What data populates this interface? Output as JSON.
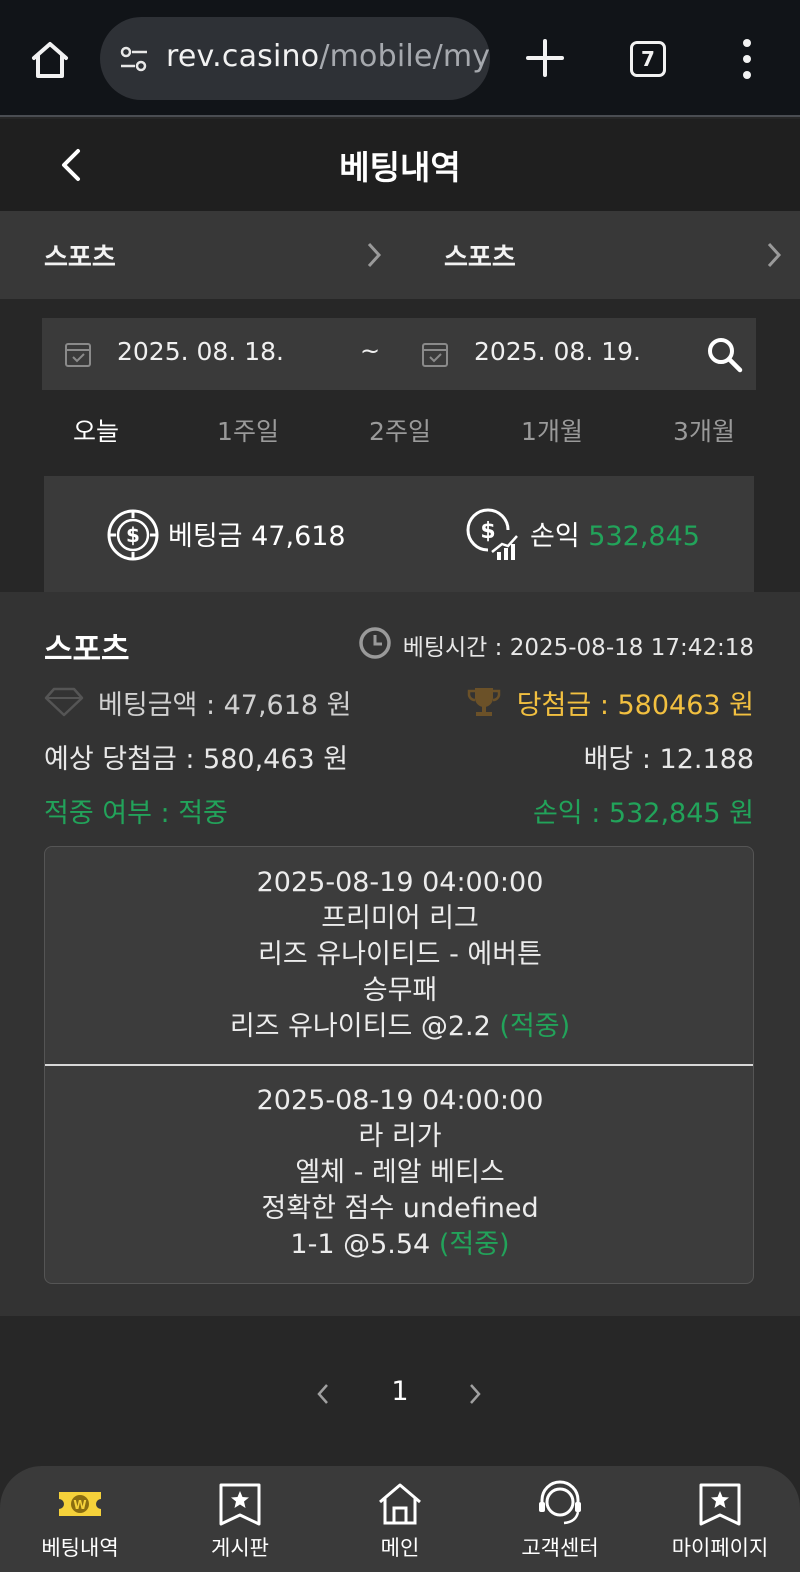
{
  "browser": {
    "url_host": "rev.casino",
    "url_path": "/mobile/my",
    "tab_count": "7"
  },
  "header": {
    "title": "베팅내역"
  },
  "filters": {
    "left_label": "스포츠",
    "right_label": "스포츠"
  },
  "date_range": {
    "from": "2025. 08. 18.",
    "separator": "~",
    "to": "2025. 08. 19."
  },
  "periods": [
    "오늘",
    "1주일",
    "2주일",
    "1개월",
    "3개월"
  ],
  "summary": {
    "bet_label": "베팅금",
    "bet_value": "47,618",
    "profit_label": "손익",
    "profit_value": "532,845"
  },
  "bet": {
    "kind": "스포츠",
    "time_text": "베팅시간 : 2025-08-18 17:42:18",
    "amount_text": "베팅금액 : 47,618 원",
    "winnings_text": "당첨금 : 580463 원",
    "expected_text": "예상 당첨금 : 580,463 원",
    "odds_text": "배당 : 12.188",
    "hit_text": "적중 여부 : 적중",
    "profit_text": "손익 : 532,845 원",
    "picks": [
      {
        "datetime": "2025-08-19 04:00:00",
        "league": "프리미어 리그",
        "match": "리즈 유나이티드 - 에버튼",
        "market": "승무패",
        "selection": "리즈 유나이티드 @2.2",
        "result": "(적중)"
      },
      {
        "datetime": "2025-08-19 04:00:00",
        "league": "라 리가",
        "match": "엘체 - 레알 베티스",
        "market": "정확한 점수 undefined",
        "selection": "1-1 @5.54",
        "result": "(적중)"
      }
    ]
  },
  "pagination": {
    "current": "1"
  },
  "bottom_nav": [
    {
      "label": "베팅내역",
      "icon": "ticket-icon"
    },
    {
      "label": "게시판",
      "icon": "bookmark-star-icon"
    },
    {
      "label": "메인",
      "icon": "home-icon"
    },
    {
      "label": "고객센터",
      "icon": "headset-icon"
    },
    {
      "label": "마이페이지",
      "icon": "bookmark-star-icon"
    }
  ],
  "colors": {
    "accent_green": "#22a35a",
    "winnings_gold": "#f2c040",
    "nav_active": "#f5d13a"
  }
}
